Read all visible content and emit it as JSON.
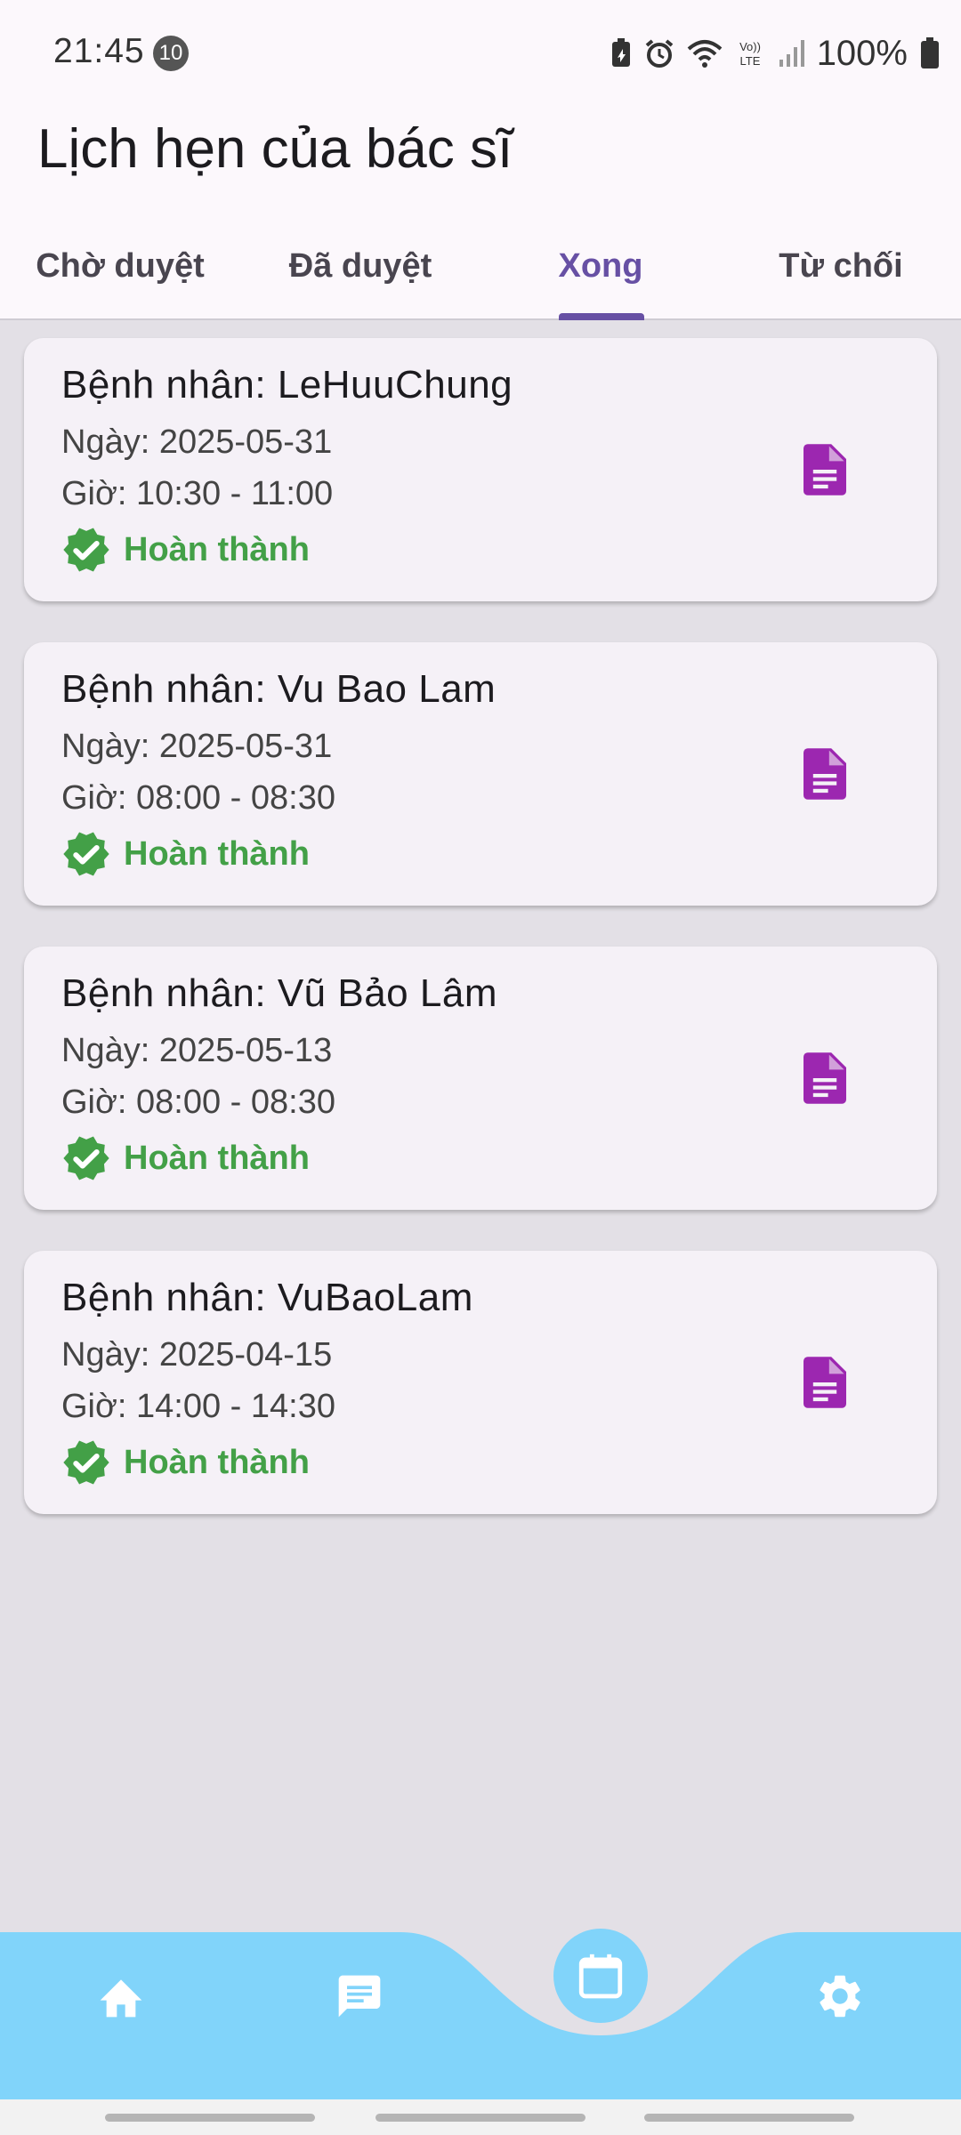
{
  "status_bar": {
    "time": "21:45",
    "notification_count": "10",
    "battery": "100%"
  },
  "header": {
    "title": "Lịch hẹn của bác sĩ"
  },
  "tabs": [
    {
      "label": "Chờ duyệt",
      "active": false
    },
    {
      "label": "Đã duyệt",
      "active": false
    },
    {
      "label": "Xong",
      "active": true
    },
    {
      "label": "Từ chối",
      "active": false
    }
  ],
  "appointments": [
    {
      "patient": "Bệnh nhân: LeHuuChung",
      "date": "Ngày: 2025-05-31",
      "time": "Giờ: 10:30 - 11:00",
      "status": "Hoàn thành"
    },
    {
      "patient": "Bệnh nhân: Vu Bao Lam",
      "date": "Ngày: 2025-05-31",
      "time": "Giờ: 08:00 - 08:30",
      "status": "Hoàn thành"
    },
    {
      "patient": "Bệnh nhân: Vũ Bảo Lâm",
      "date": "Ngày: 2025-05-13",
      "time": "Giờ: 08:00 - 08:30",
      "status": "Hoàn thành"
    },
    {
      "patient": "Bệnh nhân: VuBaoLam",
      "date": "Ngày: 2025-04-15",
      "time": "Giờ: 14:00 - 14:30",
      "status": "Hoàn thành"
    }
  ],
  "bottom_nav": {
    "items": [
      {
        "icon": "home-icon"
      },
      {
        "icon": "message-icon"
      },
      {
        "icon": "calendar-icon",
        "active": true
      },
      {
        "icon": "settings-icon"
      }
    ]
  },
  "colors": {
    "accent": "#6750a4",
    "success": "#43a047",
    "doc_icon": "#9c27b0",
    "nav_background": "#81d4fa"
  }
}
